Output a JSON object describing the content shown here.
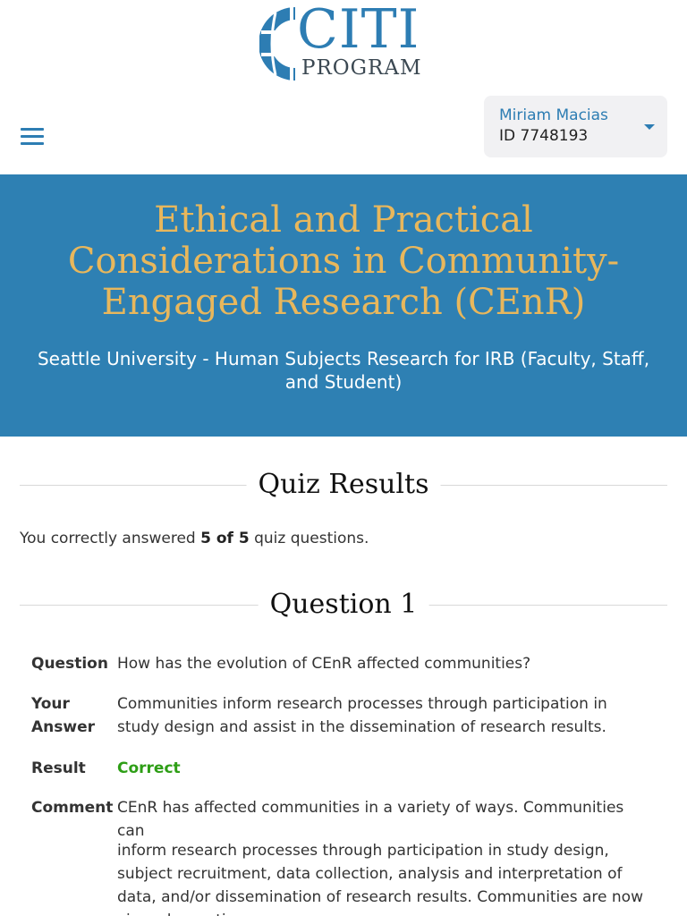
{
  "logo": {
    "line1": "CITI",
    "line2": "PROGRAM"
  },
  "user": {
    "name": "Miriam Macias",
    "id": "ID 7748193"
  },
  "banner": {
    "title": "Ethical and Practical Considerations in Community-Engaged Research (CEnR)",
    "subtitle": "Seattle University - Human Subjects Research for IRB (Faculty, Staff, and Student)"
  },
  "quiz": {
    "heading": "Quiz Results",
    "summary_prefix": "You correctly answered ",
    "summary_score": "5 of 5",
    "summary_suffix": " quiz questions."
  },
  "question1": {
    "heading": "Question 1",
    "labels": {
      "question": "Question",
      "your_answer_1": "Your",
      "your_answer_2": "Answer",
      "result": "Result",
      "comment": "Comment"
    },
    "question_text": "How has the evolution of CEnR affected communities?",
    "answer_text": "Communities inform research processes through participation in study design and assist in the dissemination of research results.",
    "result_text": "Correct",
    "comment_line1": "CEnR has affected communities in a variety of ways. Communities can",
    "comment_line2": "inform research processes through participation in study design, subject recruitment, data collection, analysis and interpretation of data, and/or dissemination of research results. Communities are now viewed as active"
  },
  "colors": {
    "brand_blue": "#2e80b3",
    "title_gold": "#e8b75c",
    "correct_green": "#2e9e16"
  },
  "icons": {
    "menu": "hamburger-icon",
    "dropdown": "caret-down-icon",
    "logo": "globe-icon"
  }
}
